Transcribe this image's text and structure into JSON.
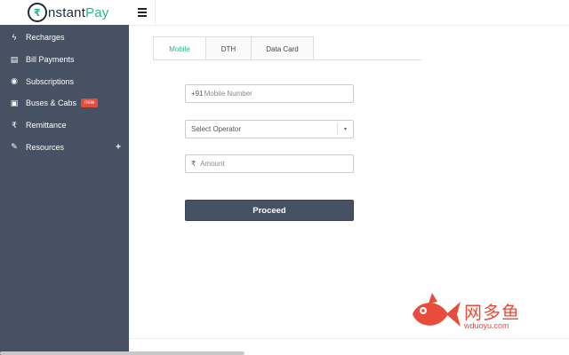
{
  "brand": {
    "logo_glyph": "₹",
    "name_part1": "nstant",
    "name_part2": "Pay",
    "accent_color": "#2bb58a",
    "dark_color": "#1f2a3a"
  },
  "sidebar": {
    "background": "#465163",
    "items": [
      {
        "label": "Recharges",
        "icon": "bolt-icon",
        "glyph": "ϟ"
      },
      {
        "label": "Bill Payments",
        "icon": "file-icon",
        "glyph": "▤"
      },
      {
        "label": "Subscriptions",
        "icon": "rss-icon",
        "glyph": "◉"
      },
      {
        "label": "Buses & Cabs",
        "icon": "bus-icon",
        "glyph": "▣",
        "badge": "new"
      },
      {
        "label": "Remittance",
        "icon": "rupee-icon",
        "glyph": "₹"
      },
      {
        "label": "Resources",
        "icon": "wrench-icon",
        "glyph": "✎",
        "expand": "+"
      }
    ]
  },
  "topbar": {
    "menu_icon": "hamburger-icon"
  },
  "tabs": [
    {
      "label": "Mobile",
      "active": true
    },
    {
      "label": "DTH",
      "active": false
    },
    {
      "label": "Data Card",
      "active": false
    }
  ],
  "form": {
    "mobile_prefix": "+91",
    "mobile_placeholder": "Mobile Number",
    "operator_placeholder": "Select Operator",
    "operator_caret": "▼",
    "amount_currency": "₹",
    "amount_placeholder": "Amount",
    "proceed_label": "Proceed",
    "proceed_color": "#465163"
  },
  "watermark": {
    "title": "网多鱼",
    "subtitle": "wduoyu.com",
    "color": "#e74c3c"
  }
}
